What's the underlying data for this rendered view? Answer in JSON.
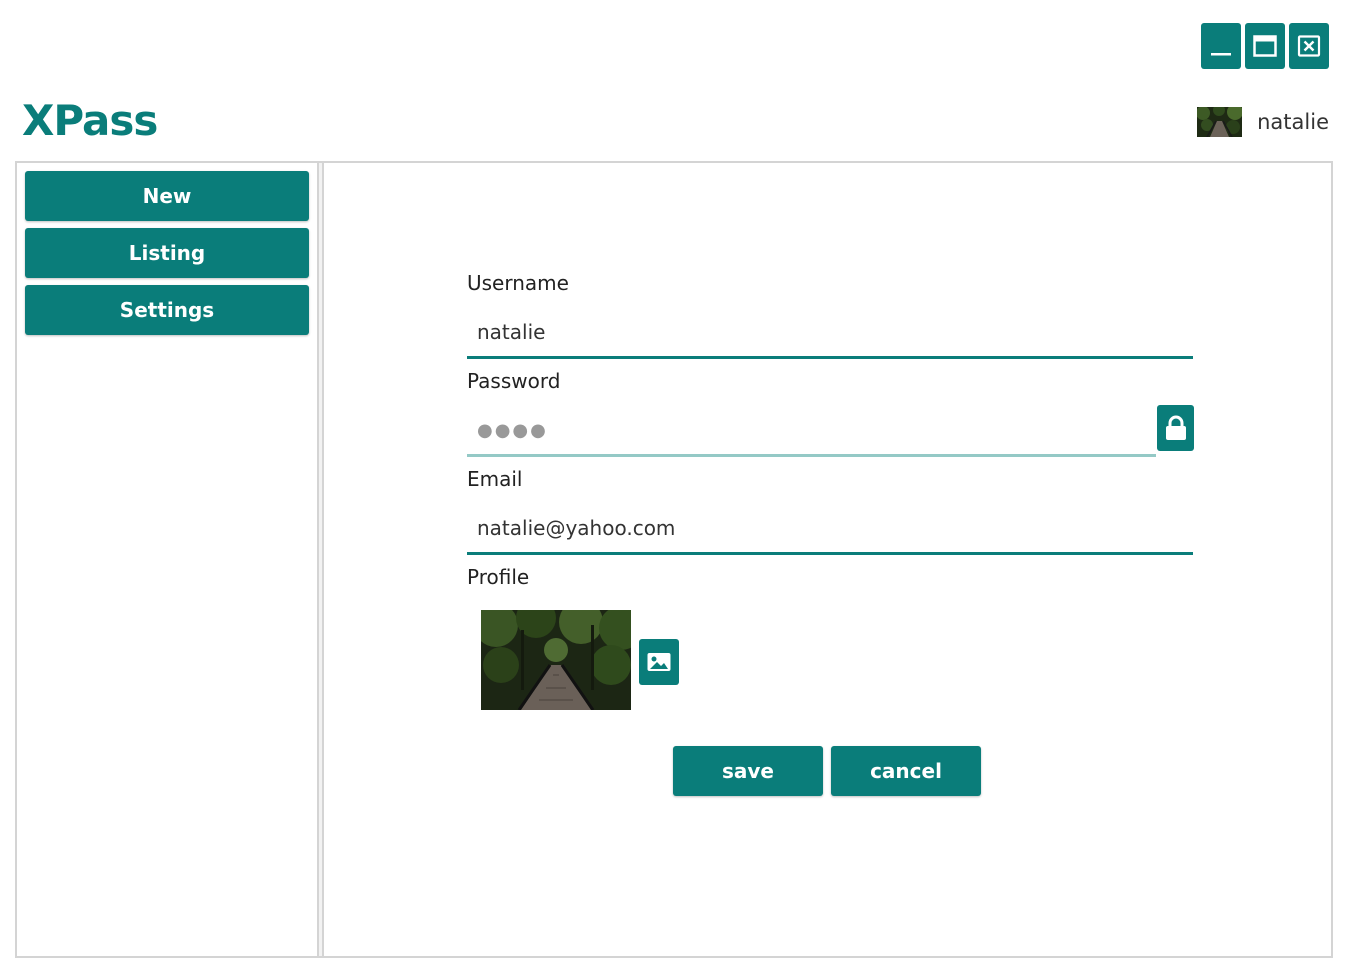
{
  "app": {
    "title": "XPass"
  },
  "window_controls": [
    {
      "name": "minimize-button",
      "icon": "minimize-icon"
    },
    {
      "name": "maximize-button",
      "icon": "maximize-icon"
    },
    {
      "name": "close-button",
      "icon": "close-icon"
    }
  ],
  "user": {
    "name": "natalie",
    "avatar_icon": "avatar-forest-image"
  },
  "sidebar": {
    "items": [
      {
        "label": "New"
      },
      {
        "label": "Listing"
      },
      {
        "label": "Settings"
      }
    ]
  },
  "form": {
    "username_label": "Username",
    "username_value": "natalie",
    "password_label": "Password",
    "password_mask": "●●●●",
    "email_label": "Email",
    "email_value": "natalie@yahoo.com",
    "profile_label": "Profile"
  },
  "actions": {
    "save_label": "save",
    "cancel_label": "cancel"
  },
  "colors": {
    "accent": "#0a7d7a",
    "accent_light": "#94c9c6",
    "frame": "#d4d4d4"
  }
}
